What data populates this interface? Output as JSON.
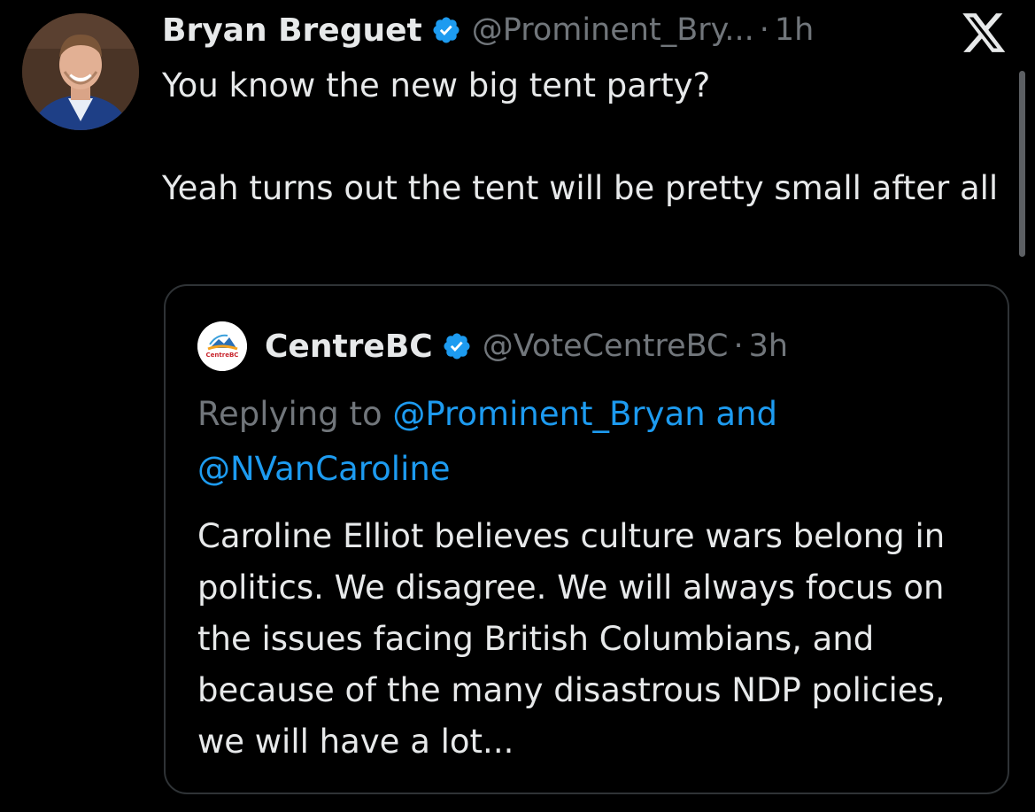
{
  "tweet": {
    "author_name": "Bryan Breguet",
    "author_handle": "@Prominent_Bry...",
    "separator": "·",
    "time": "1h",
    "text": "You know the new big tent party?\n\nYeah turns out the tent will be pretty small after all",
    "verified_icon": "verified-badge-icon",
    "app_logo_icon": "x-logo-icon"
  },
  "quoted_tweet": {
    "author_name": "CentreBC",
    "author_handle": "@VoteCentreBC",
    "separator": "·",
    "time": "3h",
    "avatar_text": "CentreBC",
    "replying_prefix": "Replying to ",
    "replying_mention_1": "@Prominent_Bryan",
    "replying_and": " and",
    "replying_mention_2": "@NVanCaroline",
    "text": "Caroline Elliot believes culture wars belong in politics. We disagree. We will always focus on the issues facing British Columbians, and because of the many disastrous NDP policies, we will have a lot..."
  },
  "colors": {
    "background": "#000000",
    "text_primary": "#e7e9ea",
    "text_secondary": "#71767b",
    "link": "#1d9bf0",
    "verified": "#1d9bf0",
    "border": "#2f3336"
  }
}
